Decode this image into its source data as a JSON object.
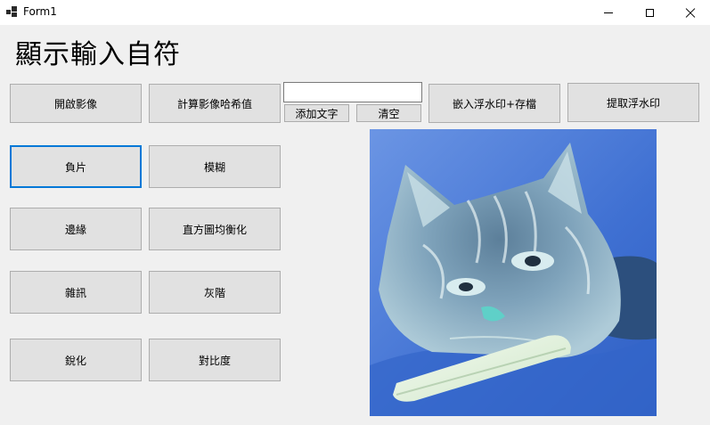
{
  "window": {
    "title": "Form1"
  },
  "heading": "顯示輸入自符",
  "toolbar": {
    "open_image": "開啟影像",
    "compute_hash": "計算影像哈希值",
    "text_input_value": "",
    "add_text": "添加文字",
    "clear": "清空",
    "embed_watermark_save": "嵌入浮水印+存檔",
    "extract_watermark": "提取浮水印"
  },
  "filters": {
    "negative": "負片",
    "blur": "模糊",
    "edge": "邊緣",
    "histogram_equalization": "直方圖均衡化",
    "noise": "雜訊",
    "grayscale": "灰階",
    "sharpen": "銳化",
    "contrast": "對比度"
  },
  "image": {
    "description_icon": "photo-icon",
    "subject": "negative-filtered cat photo"
  },
  "colors": {
    "button_bg": "#e1e1e1",
    "focus_border": "#0078d7",
    "image_bg": "#3a6fd0"
  }
}
